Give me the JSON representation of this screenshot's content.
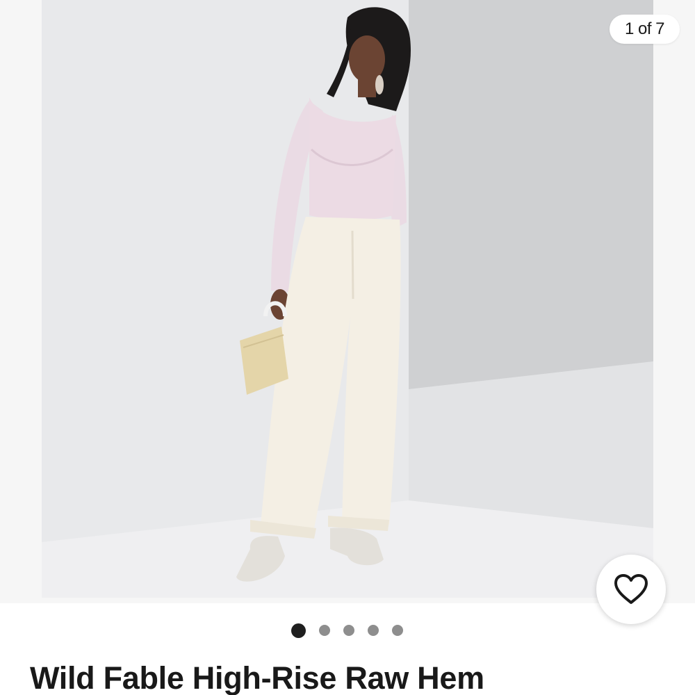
{
  "gallery": {
    "counter": "1 of 7",
    "total_images": 7,
    "current_index": 1,
    "dots_visible": 5
  },
  "product": {
    "title": "Wild Fable High-Rise Raw Hem"
  },
  "watch": {
    "icon": "heart-outline-icon"
  },
  "colors": {
    "text": "#191919",
    "dot_active": "#1f1f1f",
    "dot_inactive": "#8e8e8e"
  }
}
